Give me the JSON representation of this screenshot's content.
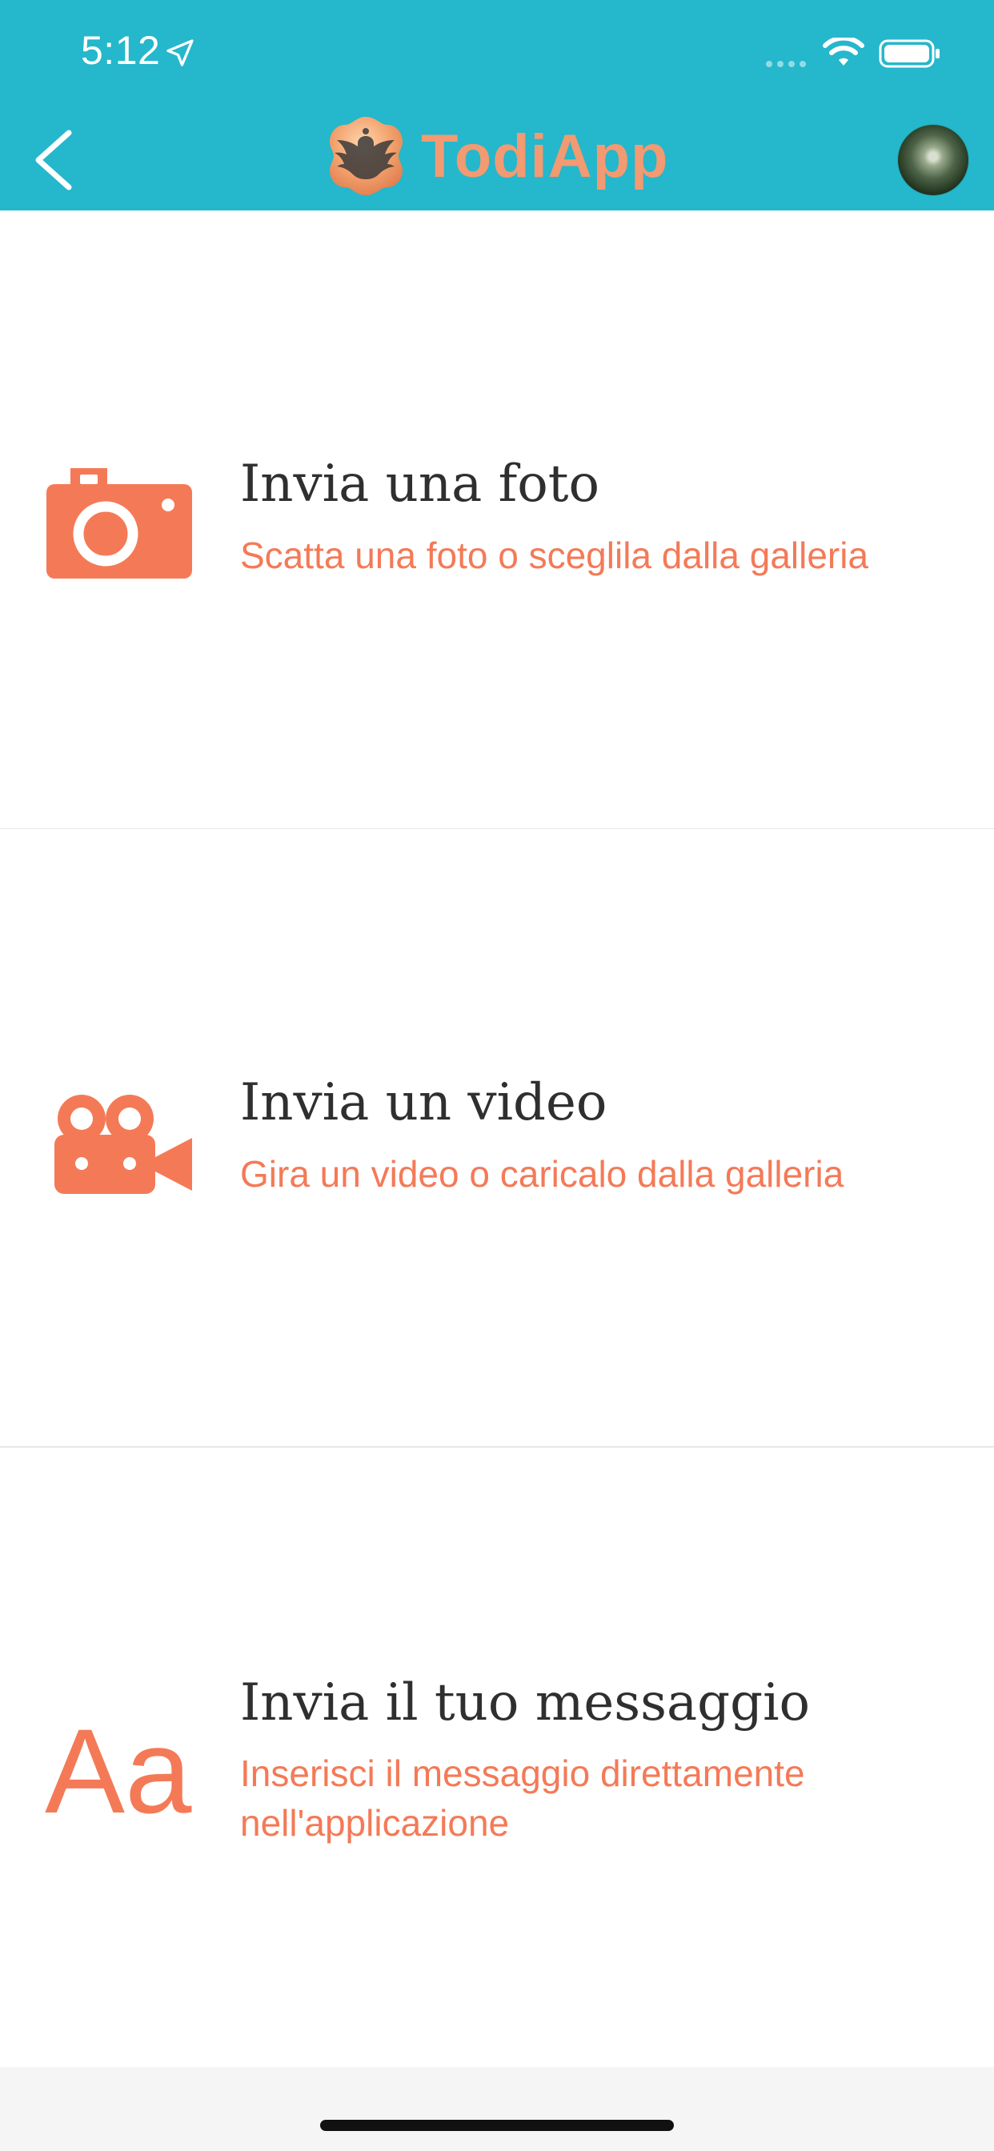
{
  "status_bar": {
    "time": "5:12",
    "location_icon": "location-arrow-icon",
    "signal_icon": "signal-dots-icon",
    "wifi_icon": "wifi-icon",
    "battery_icon": "battery-icon"
  },
  "header": {
    "back_icon": "chevron-left-icon",
    "brand": {
      "emblem_icon": "eagle-emblem-icon",
      "name": "TodiApp"
    },
    "avatar_icon": "avatar"
  },
  "options": [
    {
      "icon": "camera-icon",
      "title": "Invia una foto",
      "subtitle": "Scatta una foto o sceglila dalla galleria"
    },
    {
      "icon": "video-camera-icon",
      "title": "Invia un video",
      "subtitle": "Gira un video o caricalo dalla galleria"
    },
    {
      "icon": "text-aa-icon",
      "title": "Invia il tuo messaggio",
      "subtitle_line1": "Inserisci il messaggio direttamente",
      "subtitle_line2": "nell'applicazione",
      "subtitle": "Inserisci il messaggio direttamente nell'applicazione"
    }
  ],
  "colors": {
    "header_bg": "#25B7CB",
    "accent": "#F47A57",
    "title_text": "#2F2F2F",
    "divider": "#E6E6E6",
    "footer_bg": "#F5F5F5"
  }
}
